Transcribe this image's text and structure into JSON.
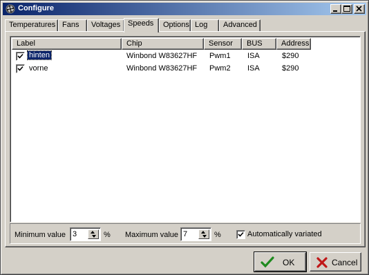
{
  "window": {
    "title": "Configure",
    "icon": "fan-icon"
  },
  "titlebar_buttons": [
    "minimize",
    "maximize",
    "close"
  ],
  "tabs": [
    {
      "label": "Temperatures"
    },
    {
      "label": "Fans"
    },
    {
      "label": "Voltages"
    },
    {
      "label": "Speeds",
      "active": true
    },
    {
      "label": "Options"
    },
    {
      "label": "Log"
    },
    {
      "label": "Advanced"
    }
  ],
  "list": {
    "columns": [
      "Label",
      "Chip",
      "Sensor",
      "BUS",
      "Address"
    ],
    "rows": [
      {
        "checked": true,
        "label": "hinten",
        "chip": "Winbond W83627HF",
        "sensor": "Pwm1",
        "bus": "ISA",
        "address": "$290",
        "selected": true
      },
      {
        "checked": true,
        "label": "vorne",
        "chip": "Winbond W83627HF",
        "sensor": "Pwm2",
        "bus": "ISA",
        "address": "$290",
        "selected": false
      }
    ]
  },
  "controls": {
    "min_label": "Minimum value",
    "min_value": "3",
    "min_unit": "%",
    "max_label": "Maximum value",
    "max_value": "7",
    "max_unit": "%",
    "auto_label": "Automatically variated",
    "auto_checked": true
  },
  "buttons": {
    "ok": "OK",
    "cancel": "Cancel"
  },
  "colors": {
    "title_active": "#0a246a",
    "selection": "#0a246a",
    "ok_check": "#1e8a1e",
    "cancel_x": "#c01818"
  }
}
